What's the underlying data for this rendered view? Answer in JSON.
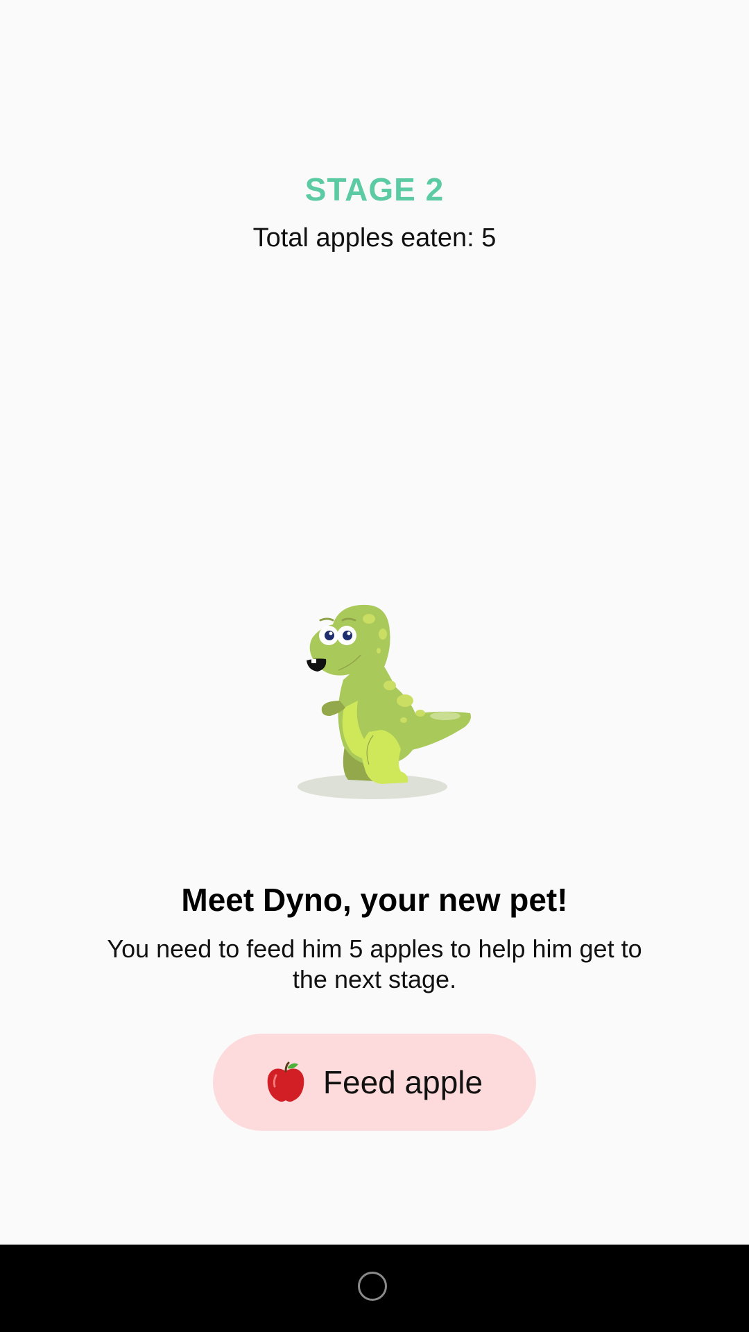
{
  "stage": {
    "title": "STAGE 2"
  },
  "stats": {
    "apples_eaten": "Total apples eaten: 5"
  },
  "pet": {
    "icon": "dinosaur-illustration"
  },
  "intro": {
    "headline": "Meet Dyno, your new pet!",
    "body": "You need to feed him 5 apples to help him get to the next stage."
  },
  "feed_button": {
    "icon": "apple-icon",
    "label": "Feed apple"
  },
  "nav": {
    "home_icon": "home-circle-icon"
  },
  "colors": {
    "stage_accent": "#5ccba4",
    "button_bg": "#fddadb",
    "dino_green": "#a9c95a",
    "dino_belly": "#cfe85a",
    "background": "#fafafa"
  }
}
